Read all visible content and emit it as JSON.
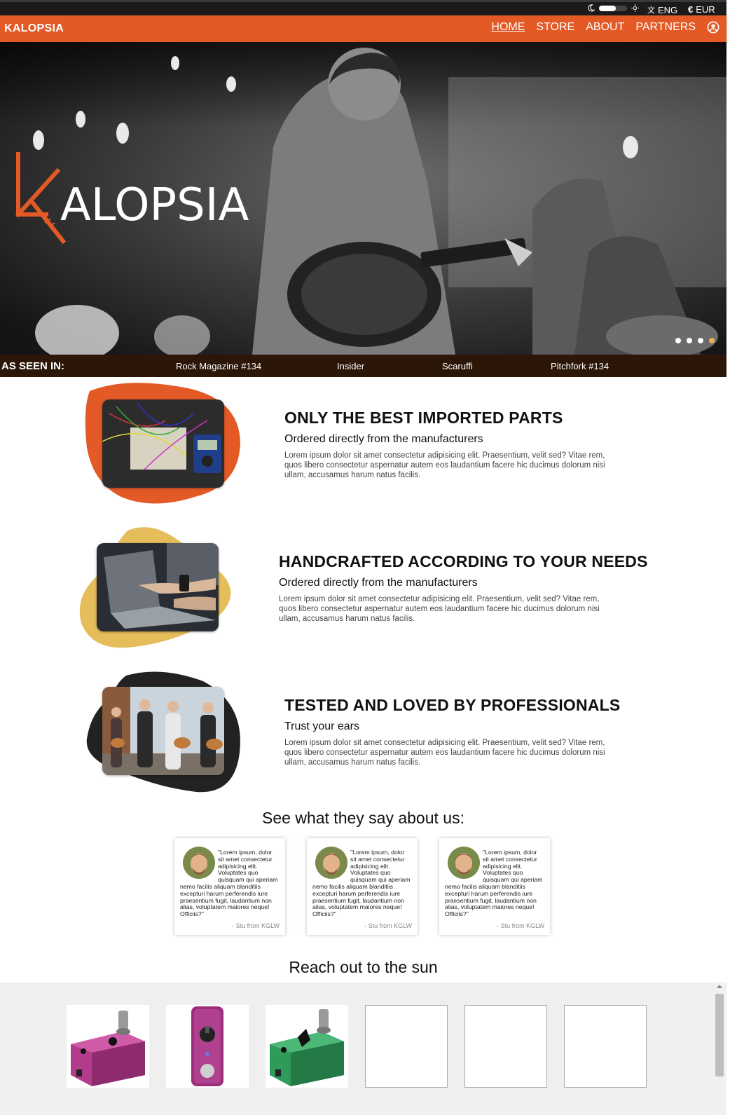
{
  "util": {
    "language": "ENG",
    "currency": "EUR",
    "dark_mode": false
  },
  "nav": {
    "brand": "KALOPSIA",
    "links": [
      "HOME",
      "STORE",
      "ABOUT",
      "PARTNERS"
    ],
    "active": "HOME"
  },
  "hero": {
    "logo_text": "ALOPSIA",
    "slide_count": 4,
    "active_slide": 4
  },
  "seen_in": {
    "label": "AS SEEN IN:",
    "items": [
      "Rock Magazine #134",
      "Insider",
      "Scaruffi",
      "Pitchfork #134"
    ]
  },
  "features": [
    {
      "title": "ONLY THE BEST IMPORTED PARTS",
      "subtitle": "Ordered directly from the manufacturers",
      "body": "Lorem ipsum dolor sit amet consectetur adipisicing elit. Praesentium, velit sed? Vitae rem, quos libero consectetur aspernatur autem eos laudantium facere hic ducimus dolorum nisi ullam, accusamus harum natus facilis."
    },
    {
      "title": "HANDCRAFTED ACCORDING TO YOUR NEEDS",
      "subtitle": "Ordered directly from the manufacturers",
      "body": "Lorem ipsum dolor sit amet consectetur adipisicing elit. Praesentium, velit sed? Vitae rem, quos libero consectetur aspernatur autem eos laudantium facere hic ducimus dolorum nisi ullam, accusamus harum natus facilis."
    },
    {
      "title": "TESTED AND LOVED BY PROFESSIONALS",
      "subtitle": "Trust your ears",
      "body": "Lorem ipsum dolor sit amet consectetur adipisicing elit. Praesentium, velit sed? Vitae rem, quos libero consectetur aspernatur autem eos laudantium facere hic ducimus dolorum nisi ullam, accusamus harum natus facilis."
    }
  ],
  "colors": {
    "brand_orange": "#e35a26",
    "blob_yellow": "#e5bd5a",
    "blob_dark": "#222222",
    "seen_bar": "#2b1608",
    "dot_active": "#e8b24a"
  },
  "testimonials": {
    "title": "See what they say about us:",
    "cards": [
      {
        "quote": "\"Lorem ipsum, dolor sit amet consectetur adipisicing elit. Voluptates quo quisquam qui aperiam nemo facilis aliquam blanditiis excepturi harum perferendis iure praesentium fugit, laudantium non alias, voluptatem maiores neque! Officiis?\"",
        "author": "- Stu from KGLW"
      },
      {
        "quote": "\"Lorem ipsum, dolor sit amet consectetur adipisicing elit. Voluptates quo quisquam qui aperiam nemo facilis aliquam blanditiis excepturi harum perferendis iure praesentium fugit, laudantium non alias, voluptatem maiores neque! Officiis?\"",
        "author": "- Stu from KGLW"
      },
      {
        "quote": "\"Lorem ipsum, dolor sit amet consectetur adipisicing elit. Voluptates quo quisquam qui aperiam nemo facilis aliquam blanditiis excepturi harum perferendis iure praesentium fugit, laudantium non alias, voluptatem maiores neque! Officiis?\"",
        "author": "- Stu from KGLW"
      }
    ]
  },
  "products": {
    "title": "Reach out to the sun",
    "items": [
      {
        "color": "#b23b8c",
        "icon": "pedal-magenta"
      },
      {
        "color": "#9b2f7a",
        "icon": "pedal-purple-upright"
      },
      {
        "color": "#2e9b5a",
        "icon": "pedal-green"
      },
      {
        "icon": "empty"
      },
      {
        "icon": "empty"
      },
      {
        "icon": "empty"
      }
    ]
  }
}
